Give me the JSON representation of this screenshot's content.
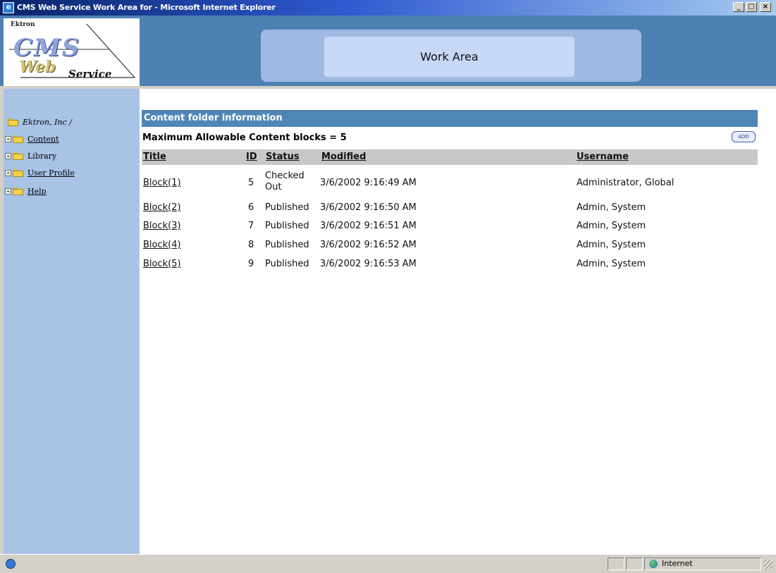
{
  "window": {
    "title": "CMS Web Service Work Area for - Microsoft Internet Explorer",
    "controls": {
      "minimize": "_",
      "maximize": "□",
      "close": "×"
    }
  },
  "header": {
    "logo": {
      "brand": "Ektron",
      "word1": "CMS",
      "word2": "Web",
      "word3": "Service"
    },
    "work_area_label": "Work Area"
  },
  "sidebar": {
    "root_label": "Ektron, Inc /",
    "items": [
      {
        "label": "Content",
        "expander": "+"
      },
      {
        "label": "Library",
        "expander": "+"
      },
      {
        "label": "User Profile",
        "expander": "+"
      },
      {
        "label": "Help",
        "expander": "+"
      }
    ]
  },
  "main": {
    "section_title": "Content folder information",
    "max_blocks_text": "Maximum Allowable Content blocks = 5",
    "add_label": "ADD",
    "columns": [
      "Title",
      "ID",
      "Status",
      "Modified",
      "Username"
    ],
    "rows": [
      {
        "title": "Block(1)",
        "id": "5",
        "status_line1": "Checked",
        "status_line2": "Out",
        "modified": "3/6/2002 9:16:49 AM",
        "username": "Administrator, Global"
      },
      {
        "title": "Block(2)",
        "id": "6",
        "status_line1": "Published",
        "status_line2": "",
        "modified": "3/6/2002 9:16:50 AM",
        "username": "Admin, System"
      },
      {
        "title": "Block(3)",
        "id": "7",
        "status_line1": "Published",
        "status_line2": "",
        "modified": "3/6/2002 9:16:51 AM",
        "username": "Admin, System"
      },
      {
        "title": "Block(4)",
        "id": "8",
        "status_line1": "Published",
        "status_line2": "",
        "modified": "3/6/2002 9:16:52 AM",
        "username": "Admin, System"
      },
      {
        "title": "Block(5)",
        "id": "9",
        "status_line1": "Published",
        "status_line2": "",
        "modified": "3/6/2002 9:16:53 AM",
        "username": "Admin, System"
      }
    ]
  },
  "statusbar": {
    "zone_label": "Internet"
  }
}
